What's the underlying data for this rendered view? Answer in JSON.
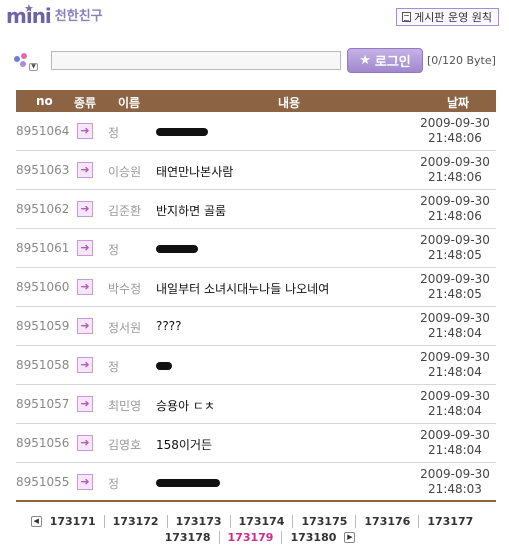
{
  "header": {
    "logo_text": "mini",
    "logo_subtitle": "천한친구",
    "rules_button": "게시판 운영 원칙"
  },
  "input_bar": {
    "message_value": "",
    "login_button": "로그인",
    "byte_counter": "[0/120 Byte]"
  },
  "table": {
    "headers": {
      "no": "no",
      "type": "종류",
      "name": "이름",
      "content": "내용",
      "date": "날짜"
    },
    "rows": [
      {
        "no": "8951064",
        "name": "정",
        "content": "",
        "redact": 52,
        "date": "2009-09-30",
        "time": "21:48:06"
      },
      {
        "no": "8951063",
        "name": "이승원",
        "content": "태연만나본사람",
        "redact": 0,
        "date": "2009-09-30",
        "time": "21:48:06"
      },
      {
        "no": "8951062",
        "name": "김준환",
        "content": "반지하면 골룸",
        "redact": 0,
        "date": "2009-09-30",
        "time": "21:48:06"
      },
      {
        "no": "8951061",
        "name": "정",
        "content": "",
        "redact": 42,
        "date": "2009-09-30",
        "time": "21:48:05"
      },
      {
        "no": "8951060",
        "name": "박수정",
        "content": "내일부터 소녀시대누나들 나오네여",
        "redact": 0,
        "date": "2009-09-30",
        "time": "21:48:05"
      },
      {
        "no": "8951059",
        "name": "정서원",
        "content": "????",
        "redact": 0,
        "date": "2009-09-30",
        "time": "21:48:04"
      },
      {
        "no": "8951058",
        "name": "정",
        "content": "",
        "redact": 16,
        "date": "2009-09-30",
        "time": "21:48:04"
      },
      {
        "no": "8951057",
        "name": "최민영",
        "content": "승용아 ㄷㅊ",
        "redact": 0,
        "date": "2009-09-30",
        "time": "21:48:04"
      },
      {
        "no": "8951056",
        "name": "김영호",
        "content": "158이거든",
        "redact": 0,
        "date": "2009-09-30",
        "time": "21:48:04"
      },
      {
        "no": "8951055",
        "name": "정",
        "content": "",
        "redact": 64,
        "date": "2009-09-30",
        "time": "21:48:03"
      }
    ]
  },
  "pagination": {
    "line1": [
      "173171",
      "173172",
      "173173",
      "173174",
      "173175",
      "173176",
      "173177"
    ],
    "line2": [
      "173178",
      "173179",
      "173180"
    ],
    "current": "173179",
    "prev_icon": "prev-arrow-icon",
    "next_icon": "next-arrow-icon"
  },
  "colors": {
    "accent": "#8c6444",
    "brand_purple": "#6f63a8",
    "current_page": "#d02b8c"
  }
}
